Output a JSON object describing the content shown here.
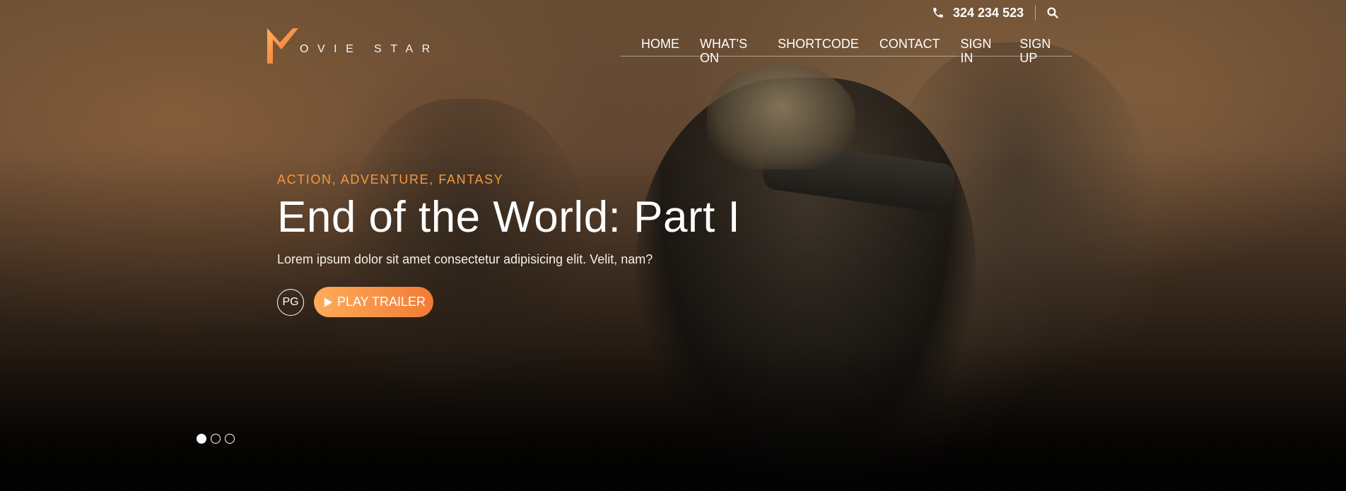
{
  "header": {
    "phone_icon": "phone-icon",
    "phone": "324 234 523",
    "search_icon": "search-icon",
    "logo": {
      "text": "OVIE STAR",
      "mark": "M",
      "mark_color": "#f27b35"
    }
  },
  "nav": {
    "items": [
      {
        "label": "HOME"
      },
      {
        "label": "WHAT'S ON"
      },
      {
        "label": "SHORTCODE"
      },
      {
        "label": "CONTACT"
      },
      {
        "label": "SIGN IN"
      },
      {
        "label": "SIGN UP"
      }
    ]
  },
  "hero": {
    "genres": "ACTION, ADVENTURE, FANTASY",
    "title": "End of the World: Part I",
    "description": "Lorem ipsum dolor sit amet consectetur adipisicing elit. Velit, nam?",
    "rating": "PG",
    "play_label": "PLAY TRAILER",
    "play_icon": "play-icon",
    "accent_color": "#f39a3f",
    "button_gradient": [
      "#ffac5a",
      "#f27b35"
    ]
  },
  "slider": {
    "total": 3,
    "active_index": 0
  }
}
